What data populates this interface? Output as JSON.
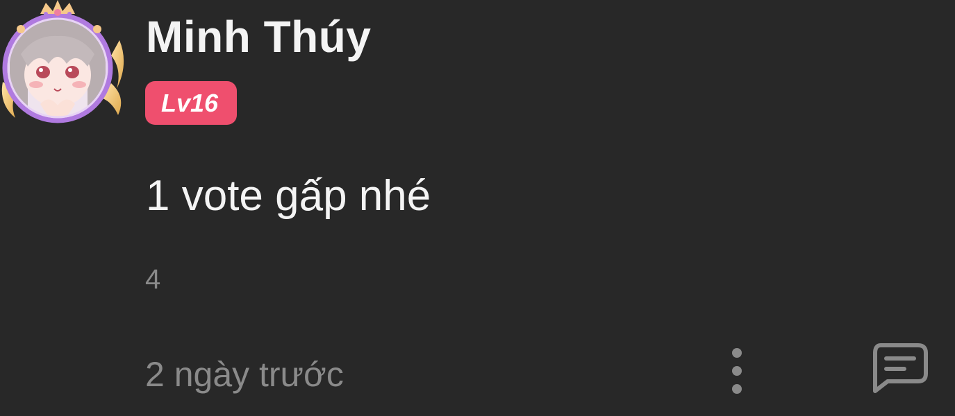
{
  "comment": {
    "username": "Minh Thúy",
    "level_badge": "Lv16",
    "body": "1 vote gấp nhé",
    "like_count": "4",
    "timestamp": "2 ngày trước"
  },
  "icons": {
    "avatar": "anime-girl-avatar-with-frame",
    "more": "more-vertical-icon",
    "reply": "comment-bubble-icon"
  },
  "colors": {
    "background": "#282828",
    "primary_text": "#f4f4f4",
    "secondary_text": "#8a8a8a",
    "badge": "#ef4f6e",
    "icon": "#8a8a8a",
    "avatar_frame": "#b07ae0"
  }
}
